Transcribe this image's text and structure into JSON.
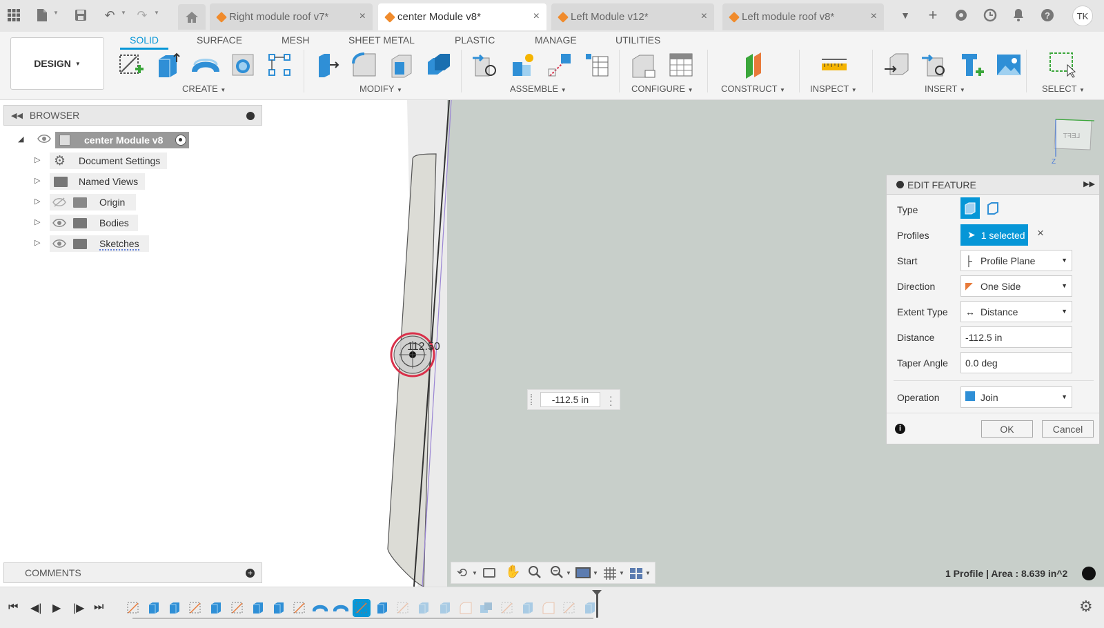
{
  "titlebar": {
    "tabs": [
      {
        "label": "Right module roof v7*",
        "active": false
      },
      {
        "label": "center Module v8*",
        "active": true
      },
      {
        "label": "Left Module v12*",
        "active": false
      },
      {
        "label": "Left module roof v8*",
        "active": false
      }
    ],
    "user_initials": "TK",
    "close_glyph": "×"
  },
  "ribbon": {
    "tabs": [
      "SOLID",
      "SURFACE",
      "MESH",
      "SHEET METAL",
      "PLASTIC",
      "MANAGE",
      "UTILITIES"
    ],
    "active_tab": "SOLID",
    "workspace_label": "DESIGN",
    "groups": [
      "CREATE",
      "MODIFY",
      "ASSEMBLE",
      "CONFIGURE",
      "CONSTRUCT",
      "INSPECT",
      "INSERT",
      "SELECT"
    ]
  },
  "browser": {
    "title": "BROWSER",
    "root": "center Module v8",
    "nodes": [
      "Document Settings",
      "Named Views",
      "Origin",
      "Bodies",
      "Sketches"
    ]
  },
  "comments": {
    "title": "COMMENTS"
  },
  "edit_feature": {
    "title": "EDIT FEATURE",
    "rows": {
      "type_label": "Type",
      "profiles_label": "Profiles",
      "profiles_value": "1 selected",
      "start_label": "Start",
      "start_value": "Profile Plane",
      "direction_label": "Direction",
      "direction_value": "One Side",
      "extent_label": "Extent Type",
      "extent_value": "Distance",
      "distance_label": "Distance",
      "distance_value": "-112.5 in",
      "taper_label": "Taper Angle",
      "taper_value": "0.0 deg",
      "operation_label": "Operation",
      "operation_value": "Join"
    },
    "ok_label": "OK",
    "cancel_label": "Cancel"
  },
  "viewport": {
    "distance_input": "-112.5 in",
    "dimension_label": "112.50",
    "viewcube_face": "LEFT",
    "axis_z": "Z"
  },
  "status": {
    "text": "1 Profile | Area : 8.639 in^2"
  },
  "colors": {
    "accent": "#0696d7",
    "canvas": "#c8cfca",
    "cube_orange": "#f08b2c",
    "profile_red": "#d9304a"
  }
}
